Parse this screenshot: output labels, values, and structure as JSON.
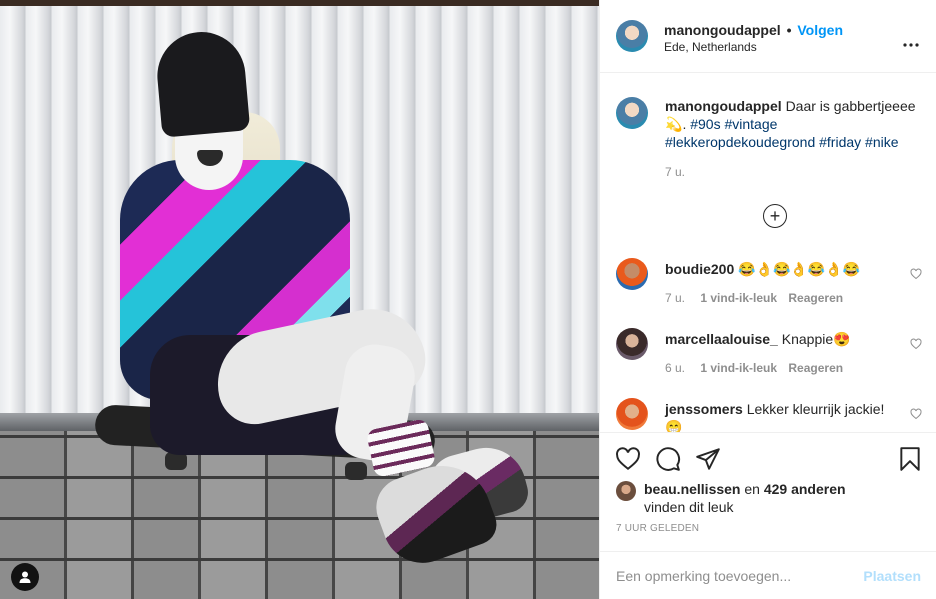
{
  "post": {
    "username": "manongoudappel",
    "follow_label": "Volgen",
    "separator": "•",
    "location": "Ede, Netherlands",
    "more_icon": "more-options-icon"
  },
  "caption": {
    "username": "manongoudappel",
    "text_before": "Daar is gabbertjeeee",
    "emoji": "💫",
    "text_after": ".",
    "hashtags": [
      "#90s",
      "#vintage",
      "#lekkeropdekoudegrond",
      "#friday",
      "#nike"
    ],
    "time": "7 u."
  },
  "comments": [
    {
      "username": "boudie200",
      "text": "😂👌😂👌😂👌😂",
      "time": "7 u.",
      "likes": "1 vind-ik-leuk",
      "reply": "Reageren"
    },
    {
      "username": "marcellaalouise_",
      "text": "Knappie😍",
      "time": "6 u.",
      "likes": "1 vind-ik-leuk",
      "reply": "Reageren"
    },
    {
      "username": "jenssomers",
      "text": "Lekker kleurrijk jackie! 😁",
      "time": "",
      "likes": "",
      "reply": ""
    }
  ],
  "likes": {
    "liker": "beau.nellissen",
    "connector": "en",
    "others": "429 anderen",
    "suffix": "vinden dit leuk"
  },
  "timestamp": "7 UUR GELEDEN",
  "add_comment": {
    "placeholder": "Een opmerking toevoegen...",
    "post_label": "Plaatsen"
  },
  "colors": {
    "link_blue": "#0095f6",
    "hashtag": "#00376b",
    "muted": "#8e8e8e",
    "post_disabled": "#b2dffc"
  }
}
